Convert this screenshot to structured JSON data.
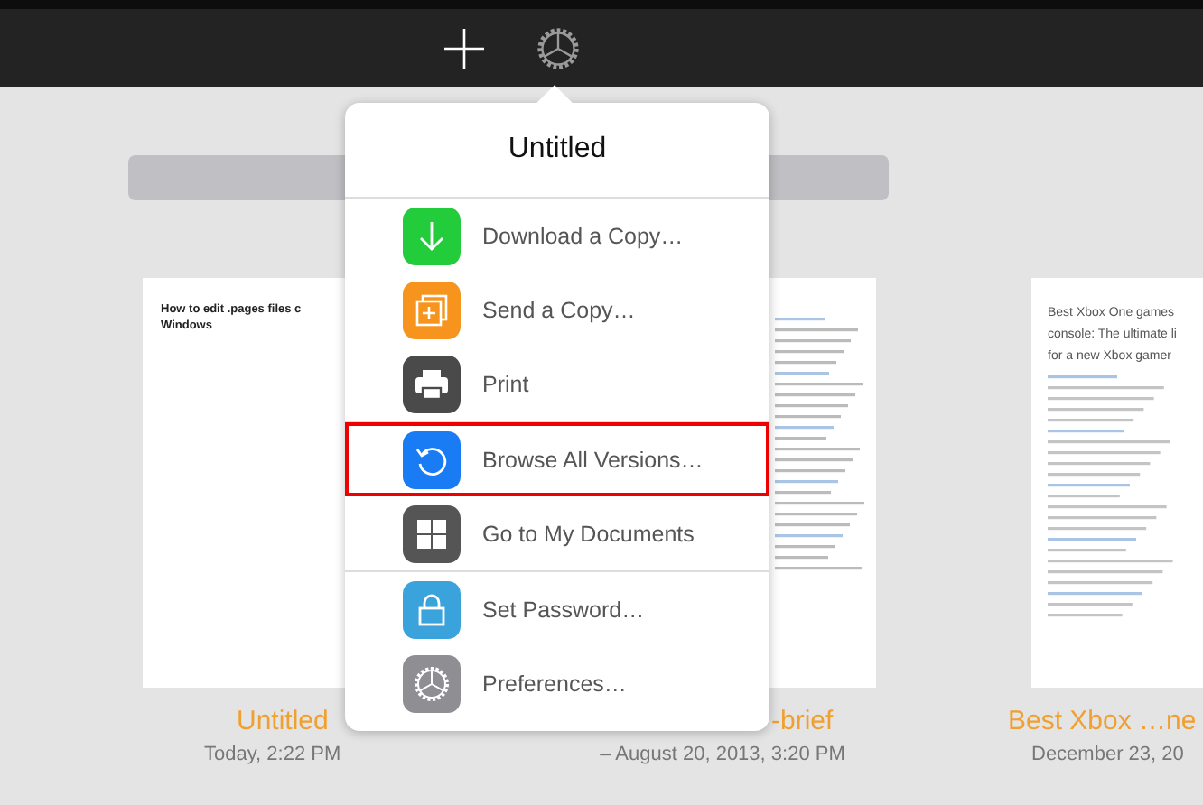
{
  "documents": [
    {
      "kind": "note",
      "preview_lines": [
        "How to edit .pages files c",
        "Windows"
      ],
      "title": "Untitled",
      "date": "Today, 2:22 PM"
    },
    {
      "kind": "report",
      "title": "-brief",
      "date": "– August 20, 2013, 3:20 PM"
    },
    {
      "kind": "article",
      "preview_lines": [
        "Best Xbox One games",
        "console: The ultimate li",
        "for a new Xbox gamer"
      ],
      "title": "Best Xbox …ne",
      "date": "December 23, 20"
    }
  ],
  "popover": {
    "title": "Untitled",
    "groups": [
      {
        "items": [
          {
            "label": "Download a Copy…",
            "highlighted": false
          },
          {
            "label": "Send a Copy…",
            "highlighted": false
          },
          {
            "label": "Print",
            "highlighted": false
          }
        ]
      },
      {
        "items": [
          {
            "label": "Browse All Versions…",
            "highlighted": true
          },
          {
            "label": "Go to My Documents",
            "highlighted": false
          }
        ]
      },
      {
        "items": [
          {
            "label": "Set Password…",
            "highlighted": false
          },
          {
            "label": "Preferences…",
            "highlighted": false
          }
        ]
      }
    ]
  }
}
